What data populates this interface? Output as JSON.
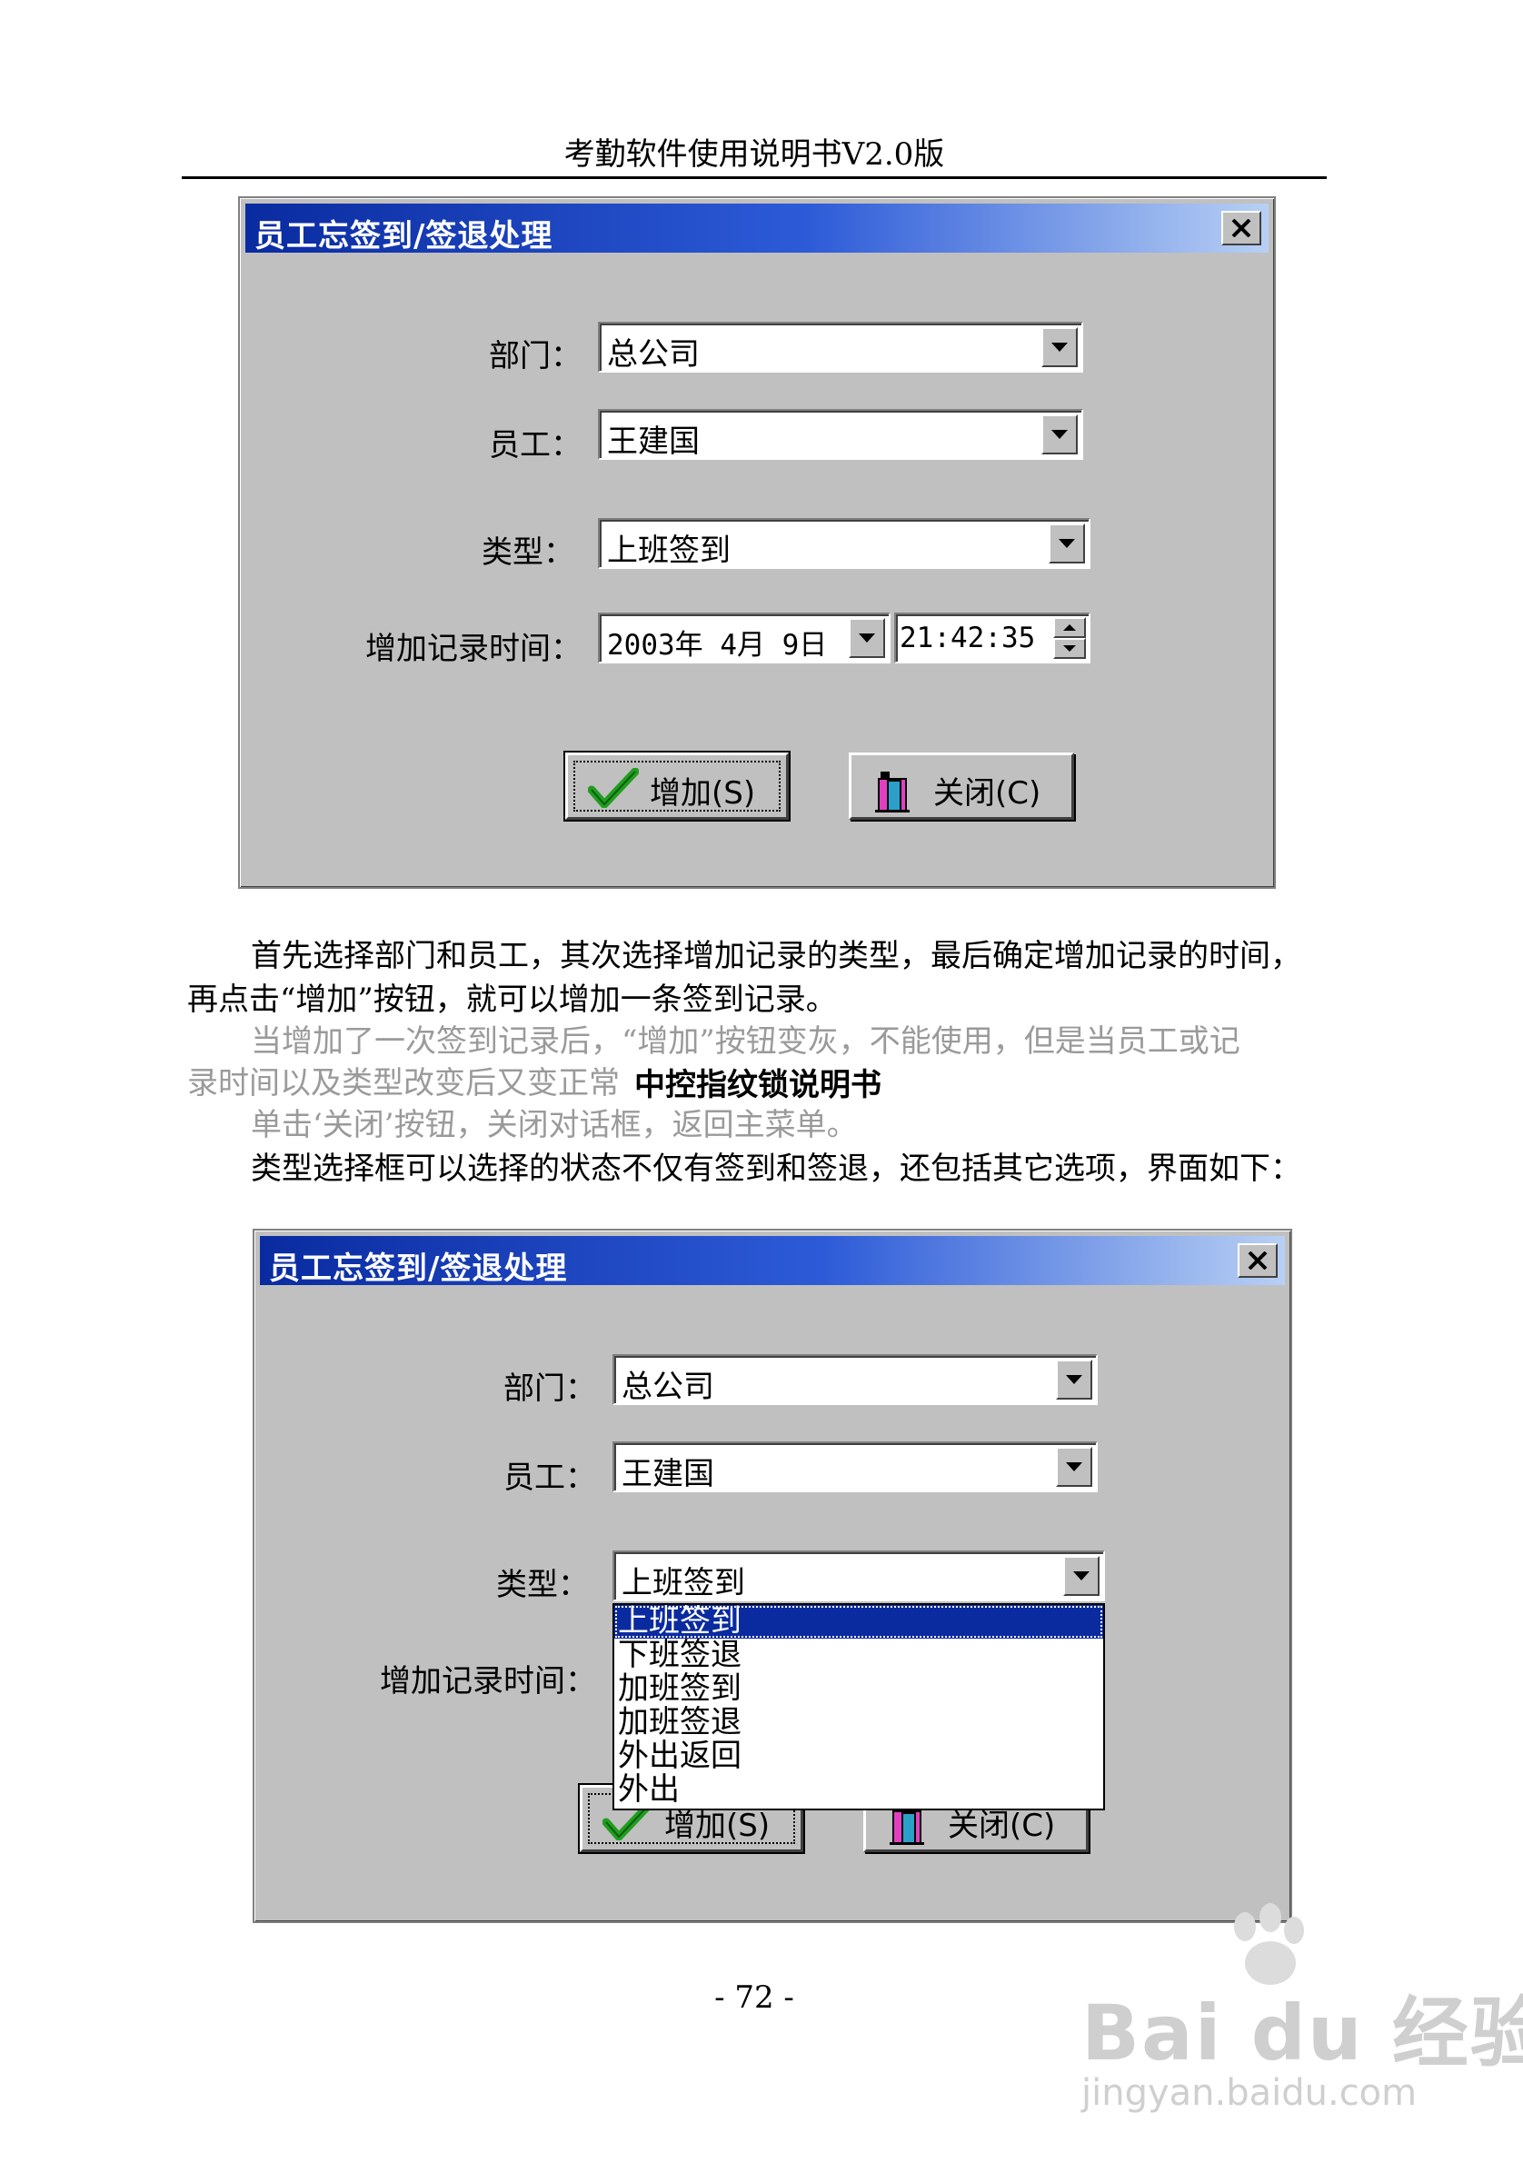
{
  "page": {
    "header": "考勤软件使用说明书V2.0版",
    "page_number": "- 72 -"
  },
  "dialog1": {
    "title": "员工忘签到/签退处理",
    "labels": {
      "dept": "部门：",
      "employee": "员工：",
      "type": "类型：",
      "time": "增加记录时间："
    },
    "values": {
      "dept": "总公司",
      "employee": "王建国",
      "type": "上班签到",
      "date": "2003年 4月 9日",
      "time": "21:42:35"
    },
    "buttons": {
      "add": "增加(S)",
      "close": "关闭(C)"
    }
  },
  "body": {
    "p1_line1": "首先选择部门和员工，其次选择增加记录的类型，最后确定增加记录的时间，",
    "p1_line2": "再点击“增加”按钮，就可以增加一条签到记录。",
    "p2_line1": "当增加了一次签到记录后，“增加”按钮变灰，不能使用，但是当员工或记",
    "p2_line2": "录时间以及类型改变后又变正常",
    "overlay_title": "中控指纹锁说明书",
    "p3": "单击‘关闭’按钮，关闭对话框，返回主菜单。",
    "p4": "类型选择框可以选择的状态不仅有签到和签退，还包括其它选项，界面如下："
  },
  "dialog2": {
    "title": "员工忘签到/签退处理",
    "labels": {
      "dept": "部门：",
      "employee": "员工：",
      "type": "类型：",
      "time": "增加记录时间："
    },
    "values": {
      "dept": "总公司",
      "employee": "王建国",
      "type": "上班签到"
    },
    "dropdown_options": [
      "上班签到",
      "下班签退",
      "加班签到",
      "加班签退",
      "外出返回",
      "外出"
    ],
    "selected_index": 0,
    "buttons": {
      "add": "增加(S)",
      "close": "关闭(C)"
    }
  },
  "watermark": {
    "line1": "Bai du 经验",
    "line2": "jingyan.baidu.com"
  },
  "colors": {
    "title_bar": "#0a2ba0",
    "dialog_face": "#c0c0c0",
    "selection": "#0a2ba0",
    "check_green": "#1f9e1f"
  }
}
